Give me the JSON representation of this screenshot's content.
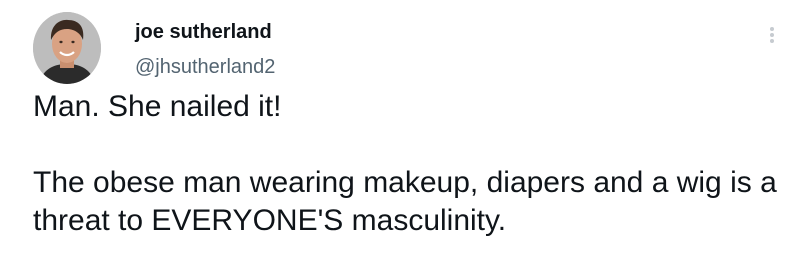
{
  "author": {
    "display_name": "joe sutherland",
    "handle": "@jhsutherland2",
    "avatar_icon": "profile-photo"
  },
  "menu": {
    "more_icon": "more-vertical-icon"
  },
  "tweet": {
    "line1": "Man. She nailed it!",
    "line2": "The obese man wearing makeup, diapers and a wig is a threat to EVERYONE'S masculinity."
  },
  "colors": {
    "text_primary": "#0f1419",
    "text_secondary": "#536471",
    "menu_dots": "#c6cbd0",
    "background": "#ffffff"
  }
}
